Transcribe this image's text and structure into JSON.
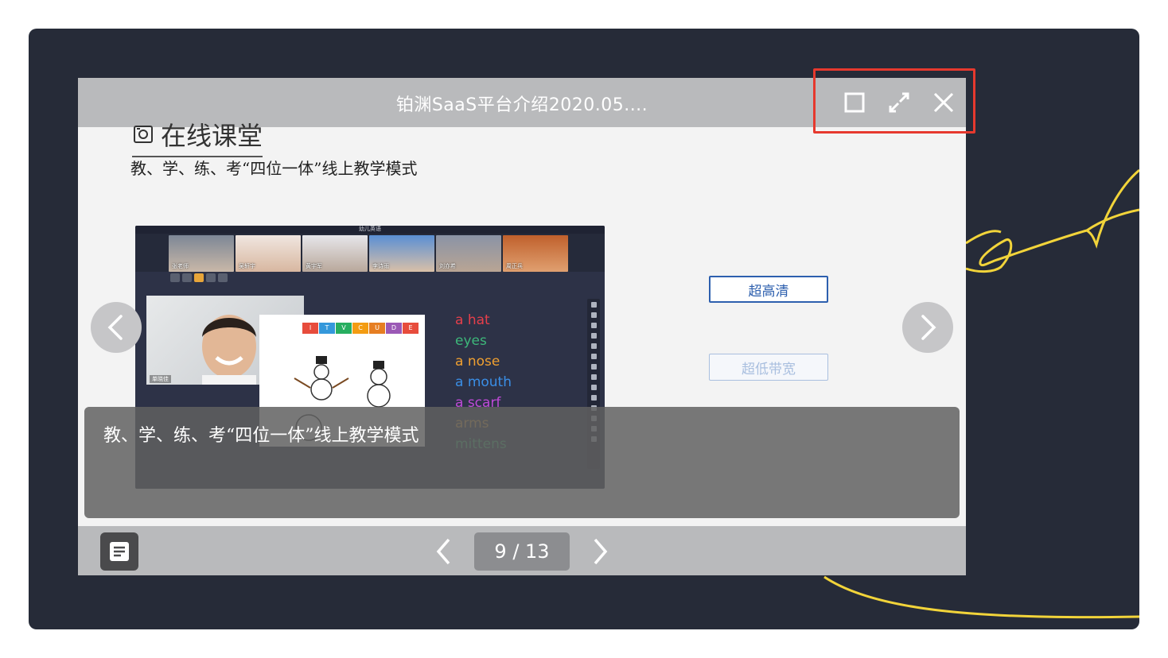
{
  "window": {
    "title": "铂渊SaaS平台介绍2020.05....",
    "buttons": [
      "restore",
      "fullscreen",
      "close"
    ]
  },
  "slide": {
    "heading": "在线课堂",
    "subheading": "教、学、练、考“四位一体”线上教学模式",
    "screenshot": {
      "app_title": "幼儿英语",
      "video_labels": [
        "张老师",
        "吴轩宇",
        "黄宇军",
        "李诗雨",
        "刘亦希",
        "周正兵"
      ],
      "boy_label": "单晓佳",
      "words": [
        {
          "text": "a hat",
          "color": "#e63f4b"
        },
        {
          "text": "eyes",
          "color": "#3db77a"
        },
        {
          "text": "a nose",
          "color": "#f0a030"
        },
        {
          "text": "a mouth",
          "color": "#3a8ee6"
        },
        {
          "text": "a scarf",
          "color": "#c04ad8"
        },
        {
          "text": "arms",
          "color": "#d9a441"
        },
        {
          "text": "mittens",
          "color": "#3fb872"
        }
      ]
    },
    "options": {
      "hd": "超高清",
      "low": "超低带宽"
    }
  },
  "caption": {
    "text": "教、学、练、考“四位一体”线上教学模式"
  },
  "pager": {
    "label": "9 / 13",
    "current": 9,
    "total": 13
  },
  "colors": {
    "stage": "#262b38",
    "bar": "#b9babc",
    "highlight": "#e6392e",
    "accent": "#2d5fae",
    "doodle": "#f2d43a"
  },
  "icons": [
    "restore-icon",
    "expand-icon",
    "close-icon",
    "chevron-left-icon",
    "chevron-right-icon",
    "notes-icon"
  ]
}
